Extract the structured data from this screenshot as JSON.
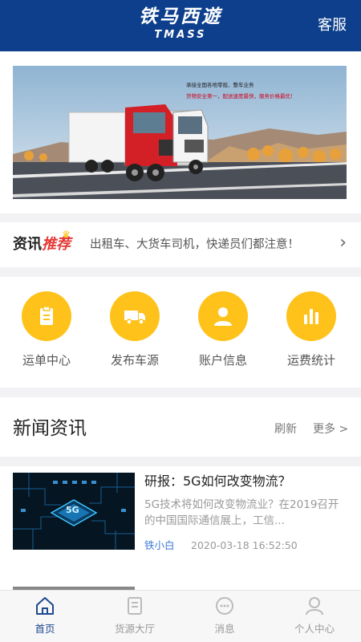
{
  "header": {
    "logo_cn": "铁马西遊",
    "logo_en": "TMASS",
    "service_label": "客服"
  },
  "banner": {
    "line1": "承接全国各地零担、整车业务",
    "line2": "货物安全第一，配送速度最快，服务价格最优！"
  },
  "ticker": {
    "title_a": "资讯",
    "title_b": "推荐",
    "text": "出租车、大货车司机，快递员们都注意！",
    "arrow": "›"
  },
  "quick_menu": [
    {
      "label": "运单中心",
      "icon": "clipboard-icon"
    },
    {
      "label": "发布车源",
      "icon": "truck-icon"
    },
    {
      "label": "账户信息",
      "icon": "user-icon"
    },
    {
      "label": "运费统计",
      "icon": "bar-chart-icon"
    }
  ],
  "news": {
    "title": "新闻资讯",
    "refresh": "刷新",
    "more": "更多 >",
    "articles": [
      {
        "title": "研报：5G如何改变物流？",
        "desc": "5G技术将如何改变物流业？在2019召开的中国国际通信展上，工信...",
        "author": "铁小白",
        "time": "2020-03-18 16:52:50",
        "thumb_text": "5G"
      }
    ]
  },
  "tabbar": [
    {
      "label": "首页",
      "icon": "home-icon",
      "active": true
    },
    {
      "label": "货源大厅",
      "icon": "document-icon",
      "active": false
    },
    {
      "label": "消息",
      "icon": "message-icon",
      "active": false
    },
    {
      "label": "个人中心",
      "icon": "person-icon",
      "active": false
    }
  ],
  "colors": {
    "header": "#0d3f8c",
    "accent_yellow": "#ffc21a",
    "active_tab": "#1e4a8f",
    "ticker_highlight": "#e53935"
  }
}
